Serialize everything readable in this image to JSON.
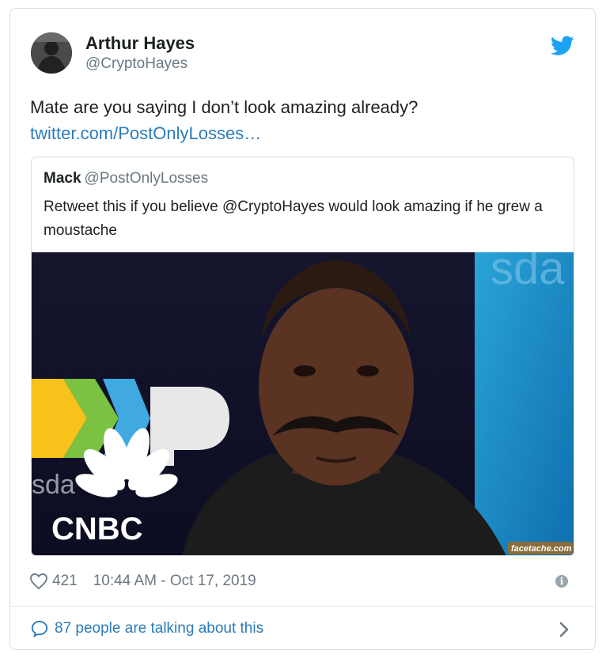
{
  "author": {
    "name": "Arthur Hayes",
    "handle": "@CryptoHayes"
  },
  "tweet": {
    "text": "Mate are you saying I don’t look amazing already?",
    "link": "twitter.com/PostOnlyLosses…"
  },
  "quoted": {
    "name": "Mack",
    "handle": "@PostOnlyLosses",
    "text": "Retweet this if you believe @CryptoHayes would look amazing if he grew a moustache",
    "image": {
      "network_logo": "CNBC",
      "watermark": "facetache.com",
      "background_letters_left": "sda",
      "background_letters_right": "sda"
    }
  },
  "meta": {
    "likes": "421",
    "timestamp": "10:44 AM - Oct 17, 2019"
  },
  "footer": {
    "talking": "87 people are talking about this"
  },
  "colors": {
    "link": "#2b7bb9",
    "bird": "#1da1f2",
    "muted": "#697882"
  }
}
